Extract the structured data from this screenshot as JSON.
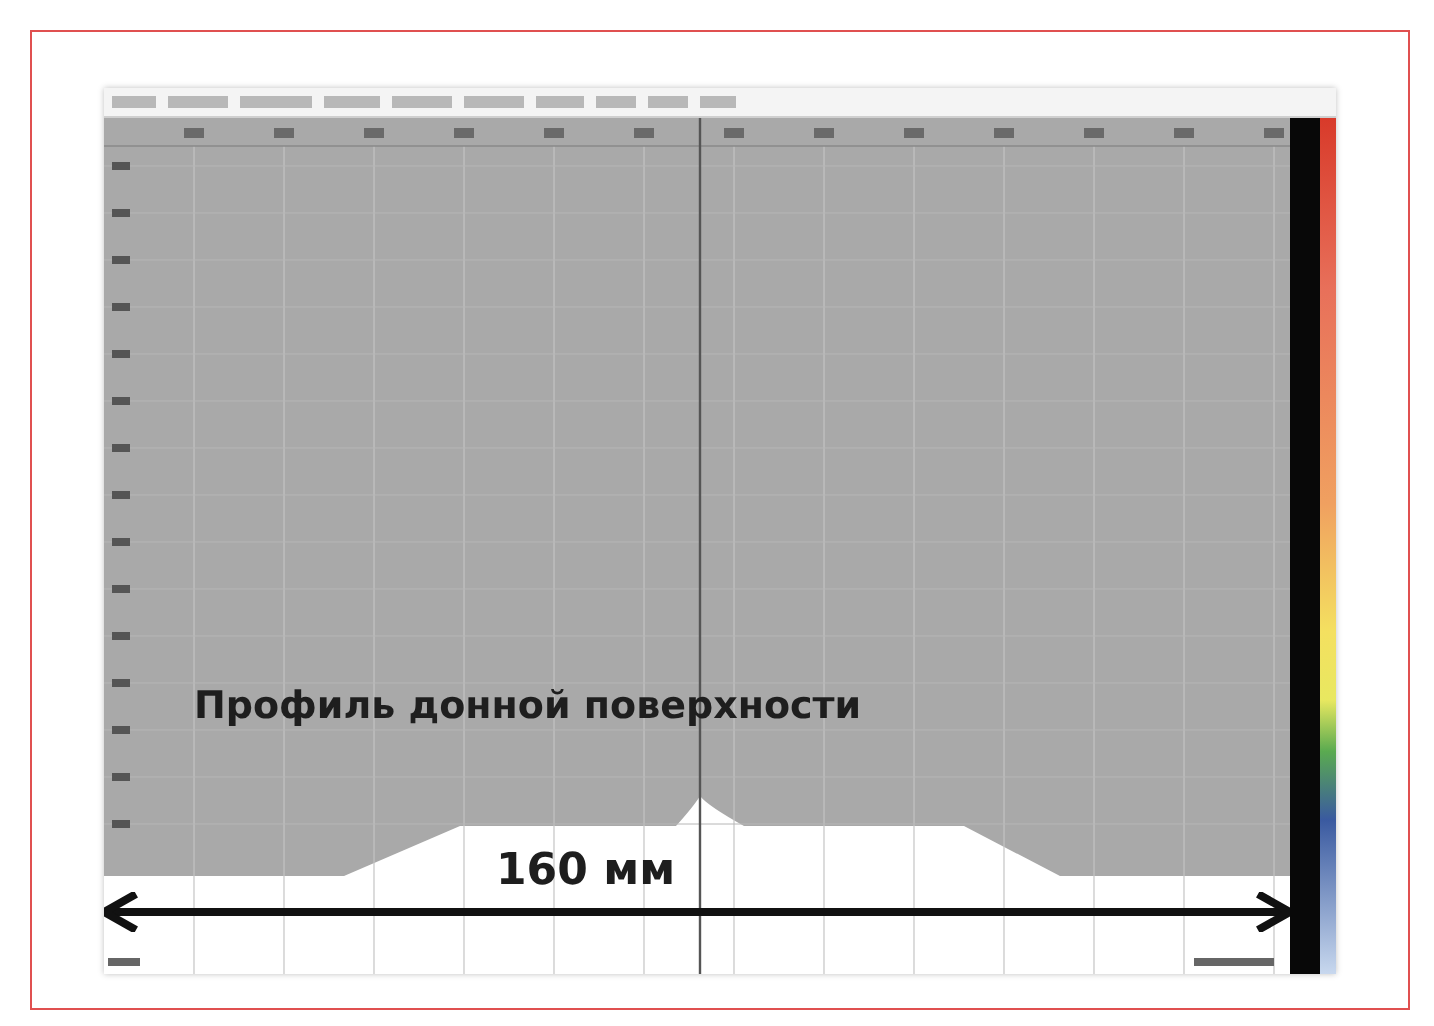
{
  "plot": {
    "caption": "Профиль донной поверхности",
    "dimension": "160 мм"
  }
}
